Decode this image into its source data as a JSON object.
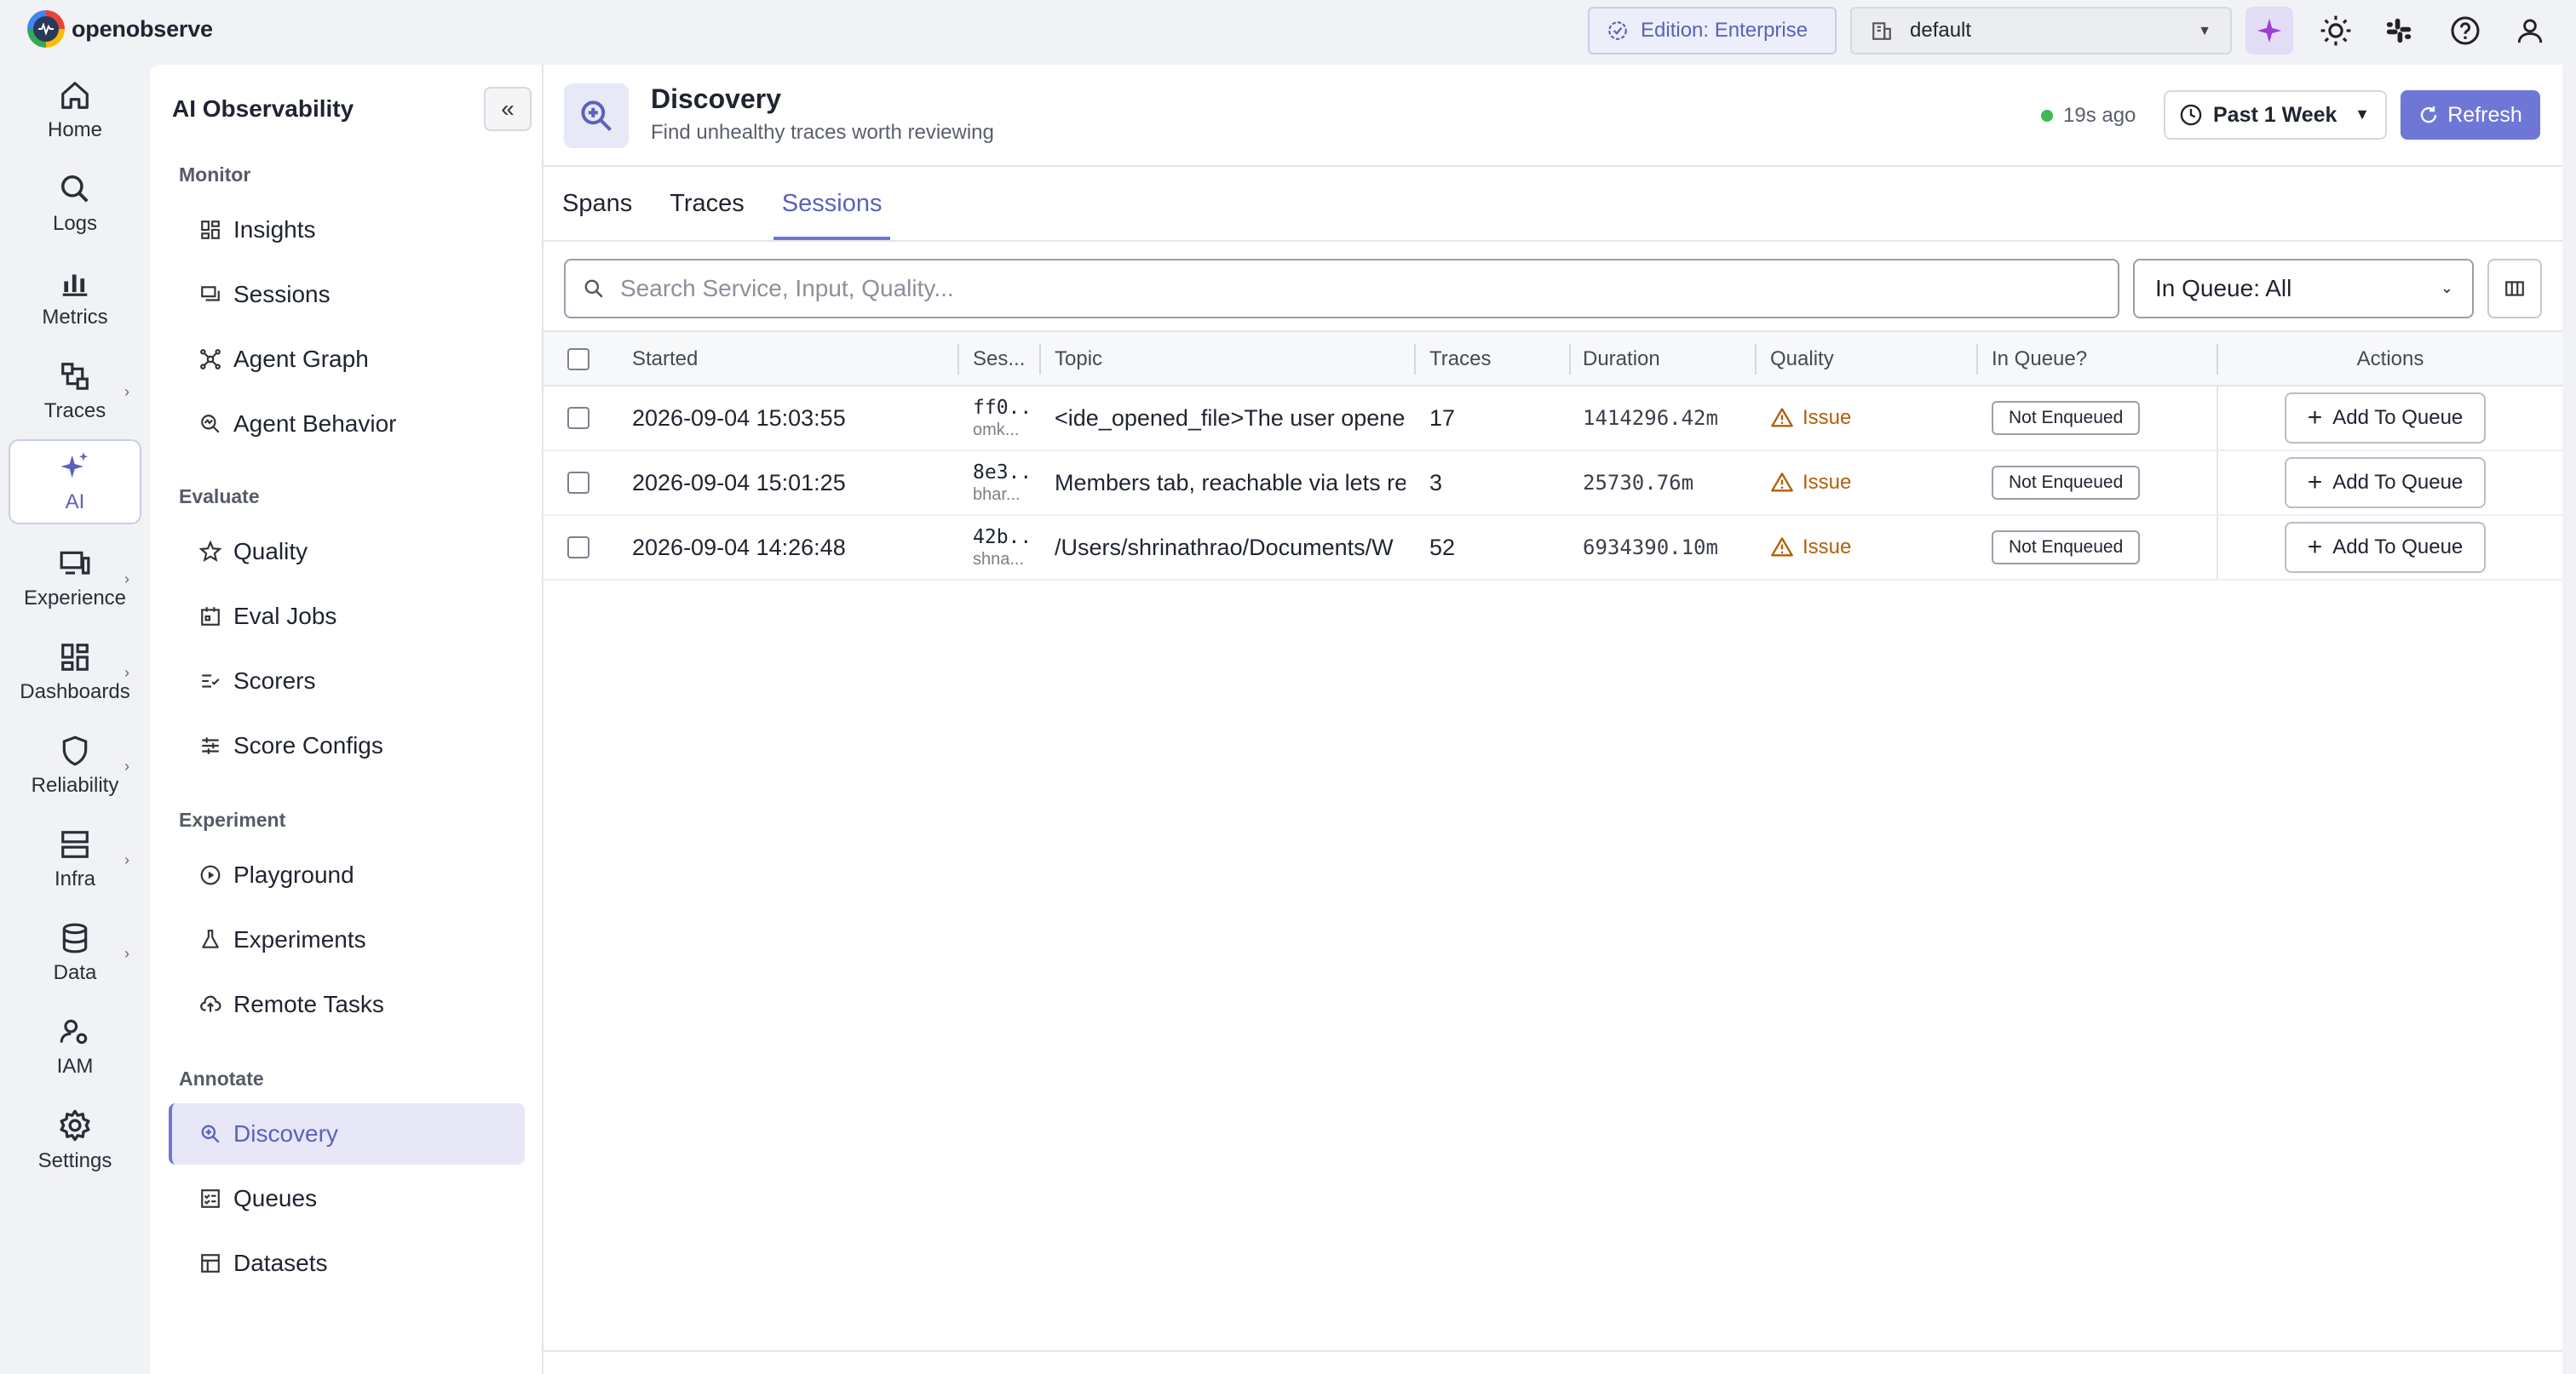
{
  "app": {
    "brand": "openobserve",
    "edition": "Edition: Enterprise",
    "org": "default"
  },
  "rail": [
    {
      "label": "Home",
      "icon": "home-icon"
    },
    {
      "label": "Logs",
      "icon": "search-icon"
    },
    {
      "label": "Metrics",
      "icon": "bar-chart-icon"
    },
    {
      "label": "Traces",
      "icon": "traces-icon"
    },
    {
      "label": "AI",
      "icon": "sparkles-icon"
    },
    {
      "label": "Experience",
      "icon": "devices-icon"
    },
    {
      "label": "Dashboards",
      "icon": "dashboard-icon"
    },
    {
      "label": "Reliability",
      "icon": "shield-icon"
    },
    {
      "label": "Infra",
      "icon": "server-icon"
    },
    {
      "label": "Data",
      "icon": "database-icon"
    },
    {
      "label": "IAM",
      "icon": "users-gear-icon"
    },
    {
      "label": "Settings",
      "icon": "gear-icon"
    }
  ],
  "subnav": {
    "title": "AI Observability",
    "sections": {
      "monitor": "Monitor",
      "evaluate": "Evaluate",
      "experiment": "Experiment",
      "annotate": "Annotate"
    },
    "items": {
      "insights": "Insights",
      "sessions": "Sessions",
      "agent_graph": "Agent Graph",
      "agent_behavior": "Agent Behavior",
      "quality": "Quality",
      "eval_jobs": "Eval Jobs",
      "scorers": "Scorers",
      "score_configs": "Score Configs",
      "playground": "Playground",
      "experiments": "Experiments",
      "remote_tasks": "Remote Tasks",
      "discovery": "Discovery",
      "queues": "Queues",
      "datasets": "Datasets"
    }
  },
  "header": {
    "title": "Discovery",
    "subtitle": "Find unhealthy traces worth reviewing",
    "last_updated": "19s ago",
    "time_range": "Past 1 Week",
    "refresh_label": "Refresh"
  },
  "tabs": [
    "Spans",
    "Traces",
    "Sessions"
  ],
  "filters": {
    "search_placeholder": "Search Service, Input, Quality...",
    "queue_filter": "In Queue: All"
  },
  "table": {
    "columns": {
      "started": "Started",
      "session": "Ses...",
      "topic": "Topic",
      "traces": "Traces",
      "duration": "Duration",
      "quality": "Quality",
      "in_queue": "In Queue?",
      "actions": "Actions"
    },
    "rows": [
      {
        "started": "2026-09-04 15:03:55",
        "session_id": "ff0...",
        "session_user": "omk...",
        "topic": "<ide_opened_file>The user opened",
        "traces": "17",
        "duration": "1414296.42m",
        "quality": "Issue",
        "in_queue": "Not Enqueued",
        "action": "Add To Queue"
      },
      {
        "started": "2026-09-04 15:01:25",
        "session_id": "8e3...",
        "session_user": "bhar...",
        "topic": "Members tab, reachable via lets re",
        "traces": "3",
        "duration": "25730.76m",
        "quality": "Issue",
        "in_queue": "Not Enqueued",
        "action": "Add To Queue"
      },
      {
        "started": "2026-09-04 14:26:48",
        "session_id": "42b...",
        "session_user": "shna...",
        "topic": "/Users/shrinathrao/Documents/W",
        "traces": "52",
        "duration": "6934390.10m",
        "quality": "Issue",
        "in_queue": "Not Enqueued",
        "action": "Add To Queue"
      }
    ]
  },
  "colors": {
    "accent": "#6e77d6",
    "issue": "#b25e0b",
    "status_ok": "#3fb950"
  }
}
